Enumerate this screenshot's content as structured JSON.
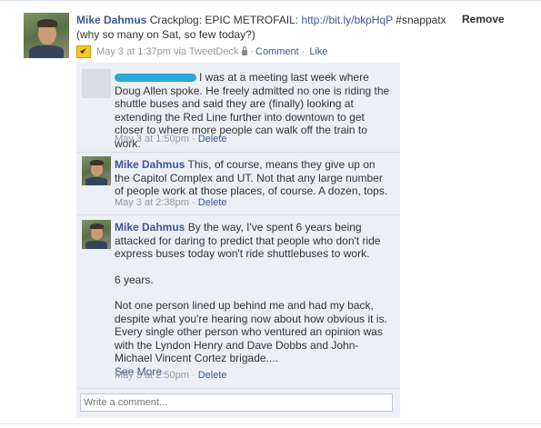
{
  "post": {
    "author": "Mike Dahmus",
    "text_before_link": "Crackplog: EPIC METROFAIL: ",
    "link": "http://bit.ly/bkpHqP",
    "text_after_link": "#snappatx (why so many on Sat, so few today?)",
    "remove_label": "Remove",
    "meta": {
      "time": "May 3 at 1:37pm via TweetDeck",
      "comment_label": "Comment",
      "like_label": "Like",
      "separator": "·"
    }
  },
  "comments": [
    {
      "author": "",
      "text": "I was at a meeting last week where Doug Allen spoke. He freely admitted no one is riding the shuttle buses and said they are (finally) looking at extending the Red Line further into downtown to get closer to where more people can walk off the train to work.",
      "time": "May 3 at 1:50pm",
      "delete_label": "Delete"
    },
    {
      "author": "Mike Dahmus",
      "text": "This, of course, means they give up on the Capitol Complex and UT. Not that any large number of people work at those places, of course. A dozen, tops.",
      "time": "May 3 at 2:38pm",
      "delete_label": "Delete"
    },
    {
      "author": "Mike Dahmus",
      "paragraphs": [
        "By the way, I've spent 6 years being attacked for daring to predict that people who don't ride express buses today won't ride shuttlebuses to work.",
        "6 years.",
        "Not one person lined up behind me and had my back, despite what you're hearing now about how obvious it is. Every single other person who ventured an opinion was with the Lyndon Henry and Dave Dobbs and John-Michael Vincent Cortez brigade...."
      ],
      "see_more": "See More",
      "time": "May 3 at 2:50pm",
      "delete_label": "Delete"
    }
  ],
  "write_comment": {
    "placeholder": "Write a comment..."
  },
  "colors": {
    "link": "#3b5998",
    "comment_bg": "#eceff5",
    "meta_text": "#999999",
    "redaction": "#2aa7d9"
  }
}
